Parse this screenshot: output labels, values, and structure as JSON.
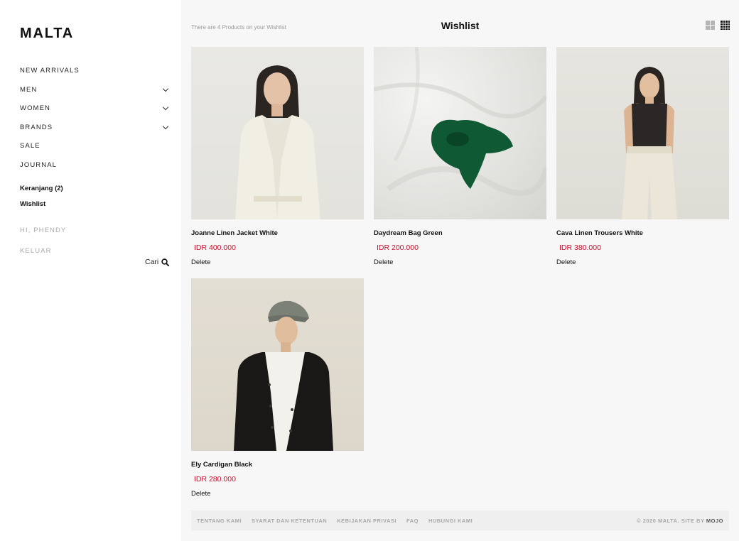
{
  "brand": {
    "logo": "MALTA"
  },
  "nav": {
    "new_arrivals": "NEW ARRIVALS",
    "men": "MEN",
    "women": "WOMEN",
    "brands": "BRANDS",
    "sale": "SALE",
    "journal": "JOURNAL",
    "cart": "Keranjang (2)",
    "wishlist": "Wishlist",
    "greeting": "HI, PHENDY",
    "logout": "KELUAR",
    "search_label": "Cari"
  },
  "header": {
    "info": "There are 4 Products on your Wishlist",
    "title": "Wishlist"
  },
  "products": [
    {
      "name": "Joanne Linen Jacket White",
      "price": "IDR 400.000",
      "delete_label": "Delete"
    },
    {
      "name": "Daydream Bag Green",
      "price": "IDR 200.000",
      "delete_label": "Delete"
    },
    {
      "name": "Cava Linen Trousers White",
      "price": "IDR 380.000",
      "delete_label": "Delete"
    },
    {
      "name": "Ely Cardigan Black",
      "price": "IDR 280.000",
      "delete_label": "Delete"
    }
  ],
  "footer": {
    "links": [
      "TENTANG KAMI",
      "SYARAT DAN KETENTUAN",
      "KEBIJAKAN PRIVASI",
      "FAQ",
      "HUBUNGI KAMI"
    ],
    "copyright": "© 2020 MALTA. SITE BY",
    "credit": "MOJO"
  },
  "colors": {
    "price": "#c8102e",
    "bag_green": "#0f5a34",
    "background": "#f7f7f7"
  },
  "icons": [
    "chevron-down-icon",
    "search-icon",
    "grid-2-view-icon",
    "grid-4-view-icon"
  ]
}
